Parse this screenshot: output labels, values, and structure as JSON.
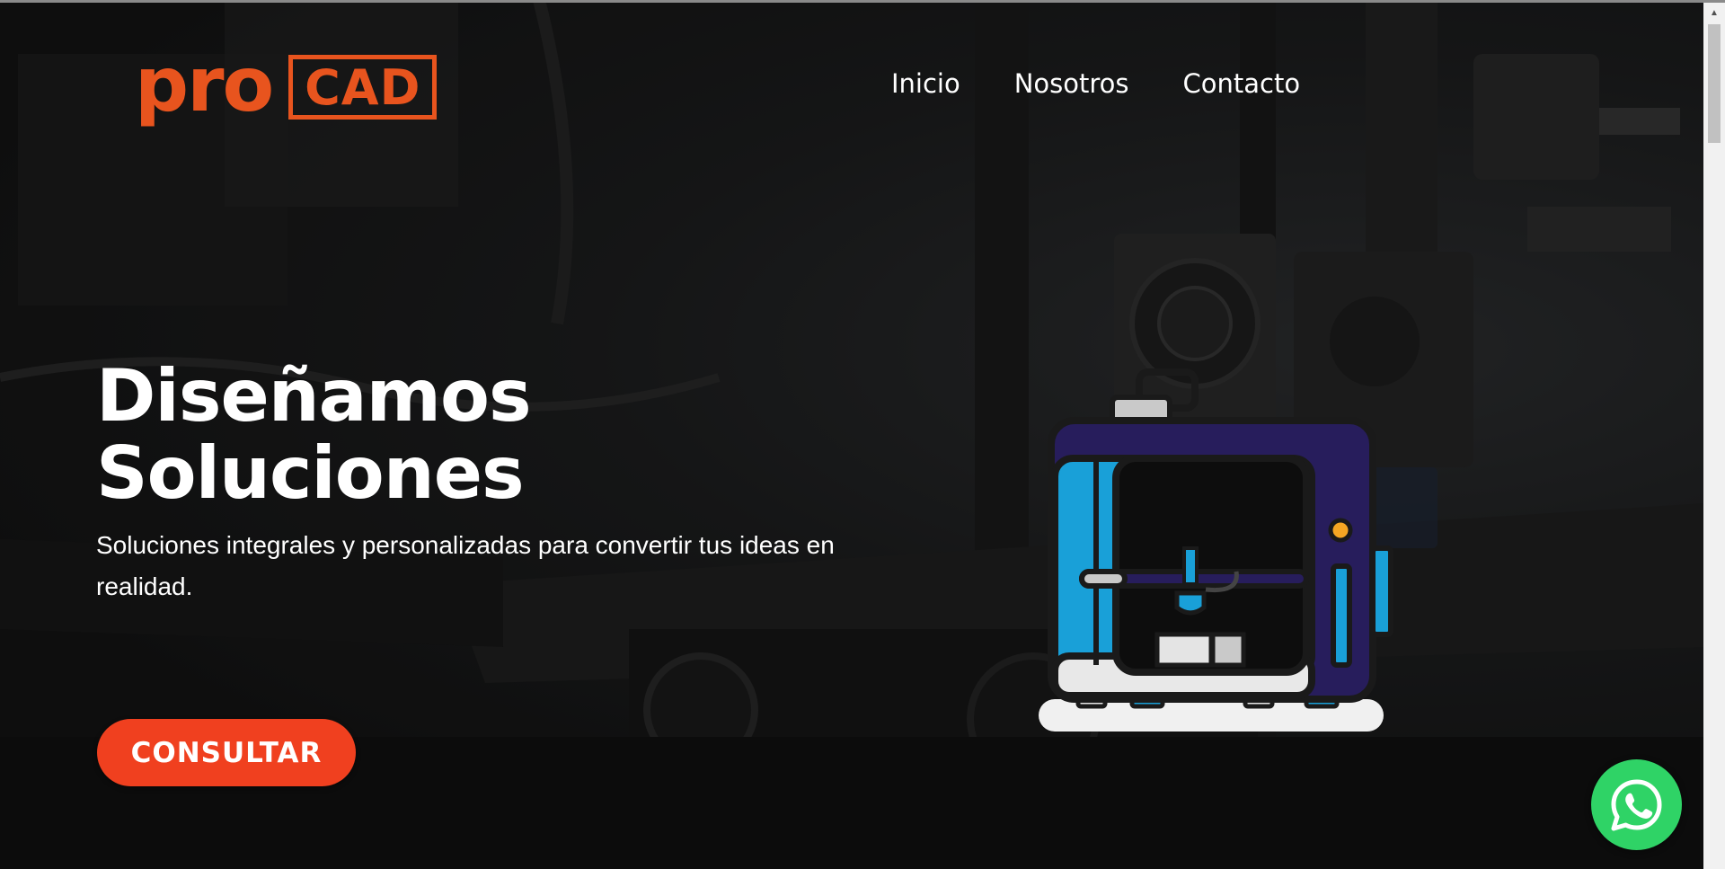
{
  "brand": {
    "logo_part1": "pro",
    "logo_part2": "CAD",
    "accent_color": "#e8541e"
  },
  "nav": {
    "items": [
      {
        "label": "Inicio"
      },
      {
        "label": "Nosotros"
      },
      {
        "label": "Contacto"
      }
    ]
  },
  "hero": {
    "title_line1": "Diseñamos",
    "title_line2": "Soluciones",
    "subtitle": "Soluciones integrales y personalizadas para convertir tus ideas en realidad.",
    "cta_label": "CONSULTAR",
    "cta_color": "#f0401f",
    "illustration_icon": "3d-printer-icon",
    "background": "dark photo of 3D printer"
  },
  "floating": {
    "whatsapp_icon": "whatsapp-icon",
    "whatsapp_color": "#2fd366"
  }
}
